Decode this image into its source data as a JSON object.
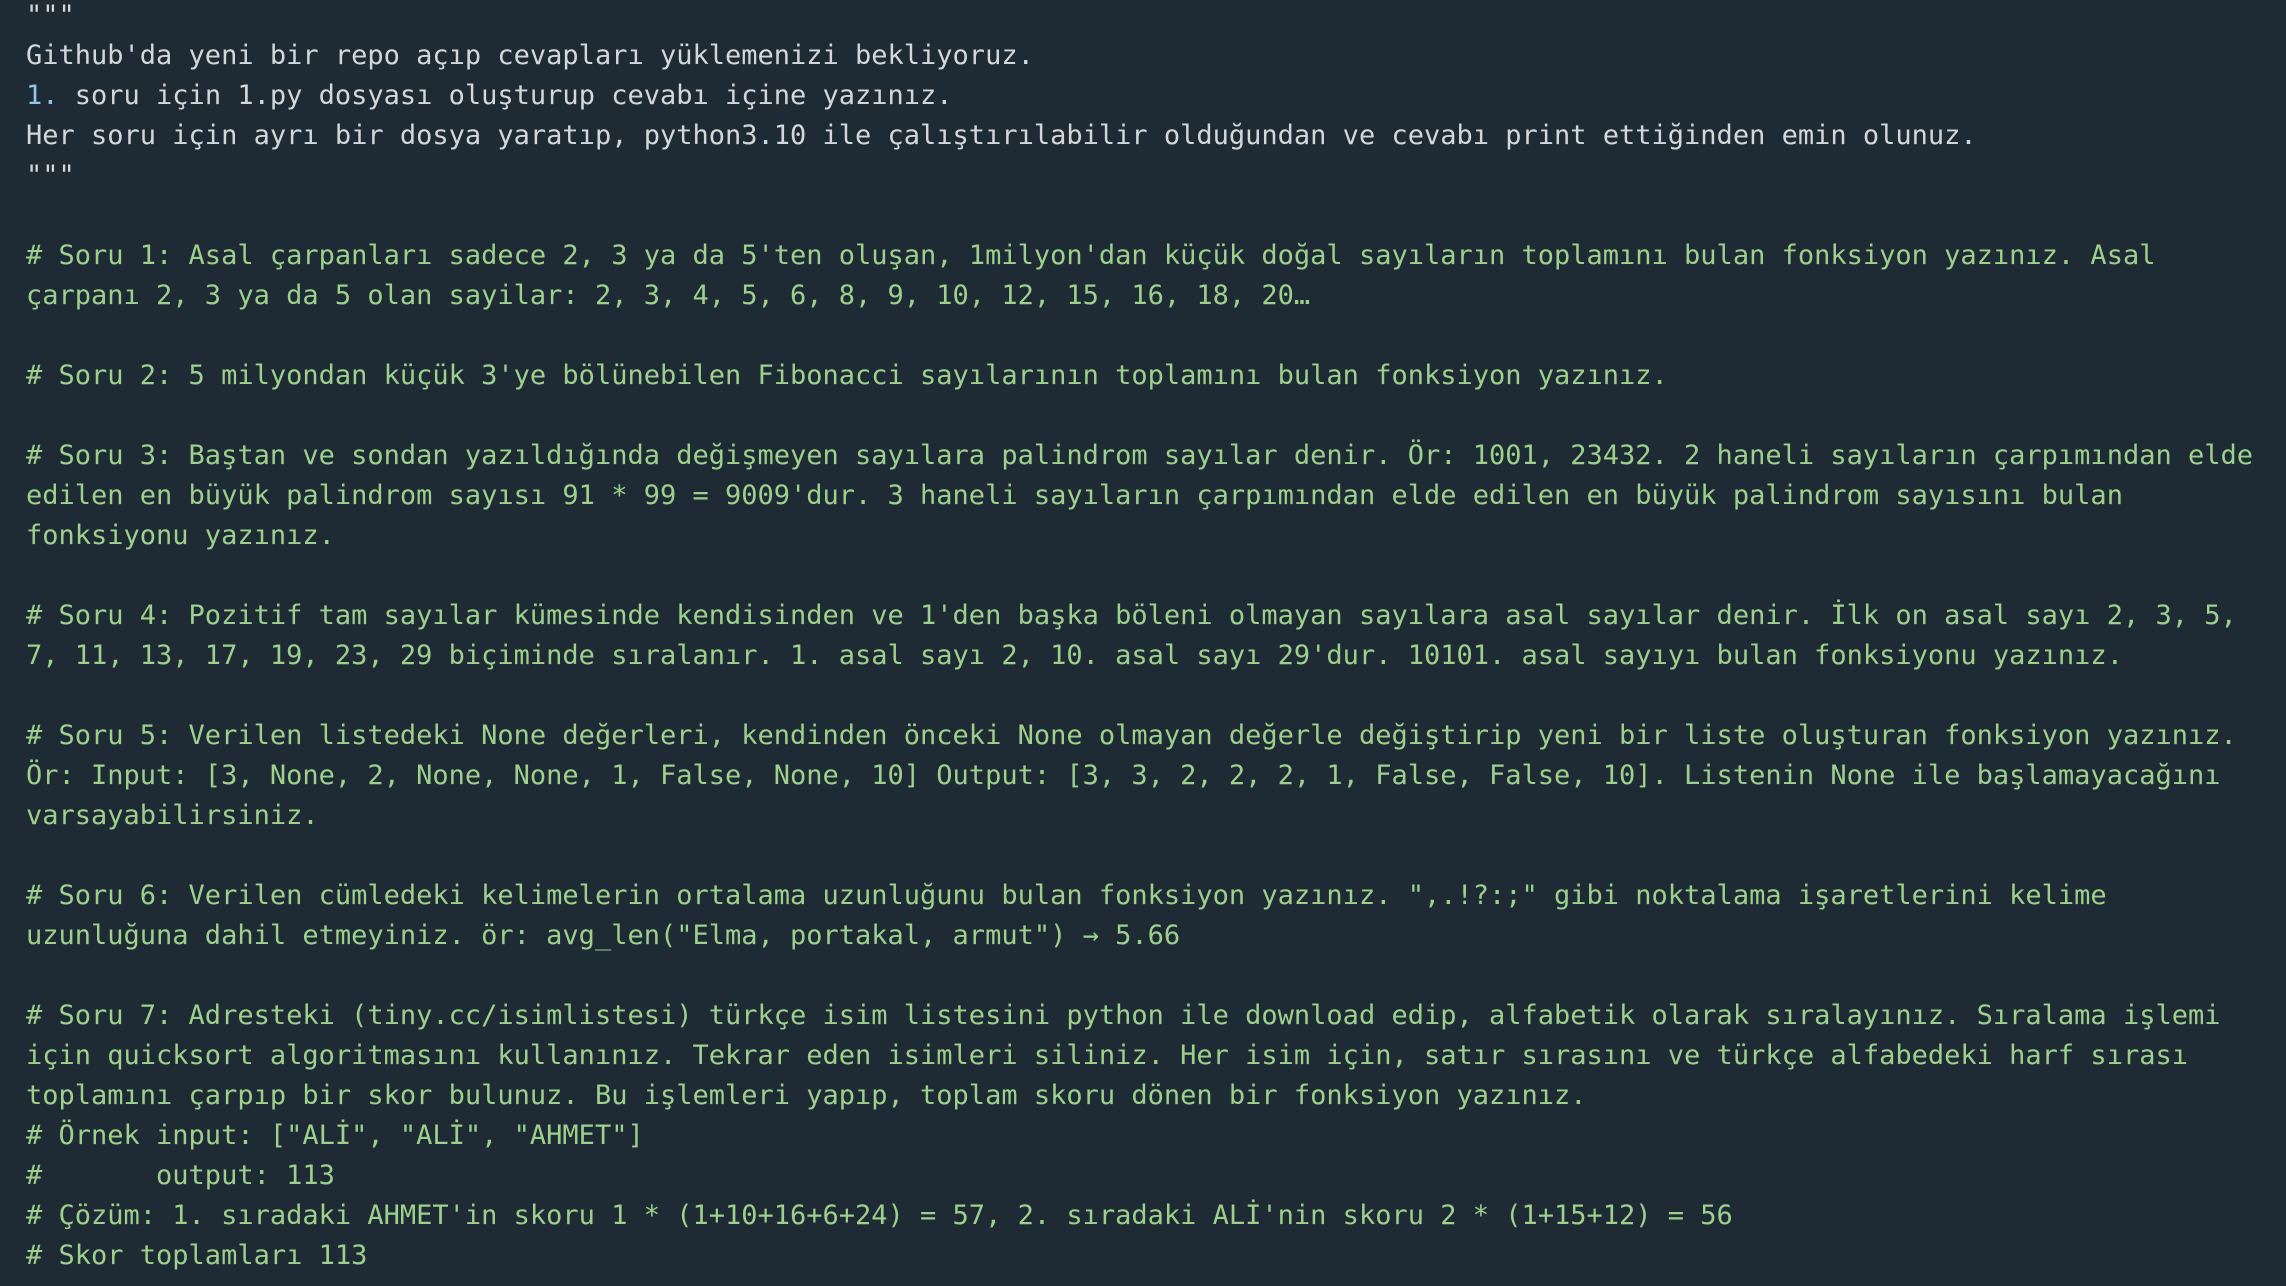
{
  "docstring": {
    "open_quotes": "\"\"\"",
    "line1": "Github'da yeni bir repo açıp cevapları yüklemenizi bekliyoruz.",
    "line2_number": "1.",
    "line2_rest": " soru için 1.py dosyası oluşturup cevabı içine yazınız.",
    "line3": "Her soru için ayrı bir dosya yaratıp, python3.10 ile çalıştırılabilir olduğundan ve cevabı print ettiğinden emin olunuz.",
    "close_quotes": "\"\"\""
  },
  "questions": [
    {
      "id": "soru-1",
      "text": "# Soru 1: Asal çarpanları sadece 2, 3 ya da 5'ten oluşan, 1milyon'dan küçük doğal sayıların toplamını bulan fonksiyon yazınız. Asal çarpanı 2, 3 ya da 5 olan sayilar: 2, 3, 4, 5, 6, 8, 9, 10, 12, 15, 16, 18, 20…"
    },
    {
      "id": "soru-2",
      "text": "# Soru 2: 5 milyondan küçük 3'ye bölünebilen Fibonacci sayılarının toplamını bulan fonksiyon yazınız."
    },
    {
      "id": "soru-3",
      "text": "# Soru 3: Baştan ve sondan yazıldığında değişmeyen sayılara palindrom sayılar denir. Ör: 1001, 23432. 2 haneli sayıların çarpımından elde edilen en büyük palindrom sayısı 91 * 99 = 9009'dur. 3 haneli sayıların çarpımından elde edilen en büyük palindrom sayısını bulan fonksiyonu yazınız."
    },
    {
      "id": "soru-4",
      "text": "# Soru 4: Pozitif tam sayılar kümesinde kendisinden ve 1'den başka böleni olmayan sayılara asal sayılar denir. İlk on asal sayı 2, 3, 5, 7, 11, 13, 17, 19, 23, 29 biçiminde sıralanır. 1. asal sayı 2, 10. asal sayı 29'dur. 10101. asal sayıyı bulan fonksiyonu yazınız."
    },
    {
      "id": "soru-5",
      "text": "# Soru 5: Verilen listedeki None değerleri, kendinden önceki None olmayan değerle değiştirip yeni bir liste oluşturan fonksiyon yazınız. Ör: Input: [3, None, 2, None, None, 1, False, None, 10] Output: [3, 3, 2, 2, 2, 1, False, False, 10]. Listenin None ile başlamayacağını varsayabilirsiniz."
    },
    {
      "id": "soru-6",
      "text": "# Soru 6: Verilen cümledeki kelimelerin ortalama uzunluğunu bulan fonksiyon yazınız. \",.!?:;\" gibi noktalama işaretlerini kelime uzunluğuna dahil etmeyiniz. ör: avg_len(\"Elma, portakal, armut\") → 5.66"
    },
    {
      "id": "soru-7",
      "text": "# Soru 7: Adresteki (tiny.cc/isimlistesi) türkçe isim listesini python ile download edip, alfabetik olarak sıralayınız. Sıralama işlemi için quicksort algoritmasını kullanınız. Tekrar eden isimleri siliniz. Her isim için, satır sırasını ve türkçe alfabedeki harf sırası toplamını çarpıp bir skor bulunuz. Bu işlemleri yapıp, toplam skoru dönen bir fonksiyon yazınız."
    }
  ],
  "example": {
    "input": "# Örnek input: [\"ALİ\", \"ALİ\", \"AHMET\"]",
    "output": "#       output: 113",
    "solution": "# Çözüm: 1. sıradaki AHMET'in skoru 1 * (1+10+16+6+24) = 57, 2. sıradaki ALİ'nin skoru 2 * (1+15+12) = 56",
    "total": "# Skor toplamları 113"
  }
}
